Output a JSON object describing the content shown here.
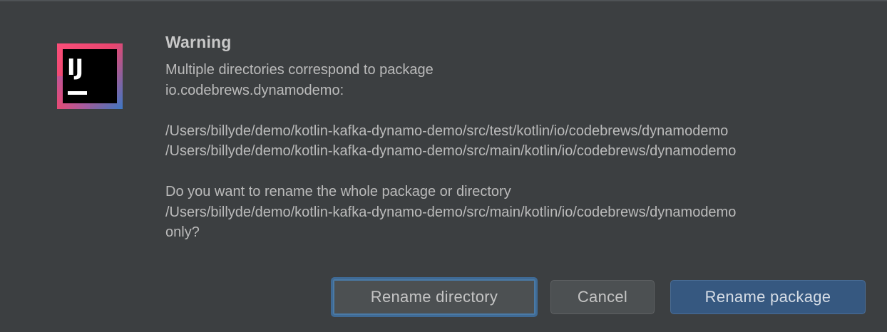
{
  "dialog": {
    "title": "Warning",
    "app_icon": "intellij-idea-icon",
    "app_icon_text": "IJ",
    "message": {
      "line1": "Multiple directories correspond to package",
      "line2": "io.codebrews.dynamodemo:",
      "path1": "/Users/billyde/demo/kotlin-kafka-dynamo-demo/src/test/kotlin/io/codebrews/dynamodemo",
      "path2": "/Users/billyde/demo/kotlin-kafka-dynamo-demo/src/main/kotlin/io/codebrews/dynamodemo",
      "question_line1": "Do you want to rename the whole package or directory",
      "question_path": "/Users/billyde/demo/kotlin-kafka-dynamo-demo/src/main/kotlin/io/codebrews/dynamodemo",
      "question_line3": "only?"
    },
    "buttons": {
      "rename_directory": "Rename directory",
      "cancel": "Cancel",
      "rename_package": "Rename package"
    },
    "colors": {
      "background": "#3c3f41",
      "text": "#bbbbbb",
      "primary_button": "#365880",
      "focus_ring": "#3f6a95"
    }
  }
}
